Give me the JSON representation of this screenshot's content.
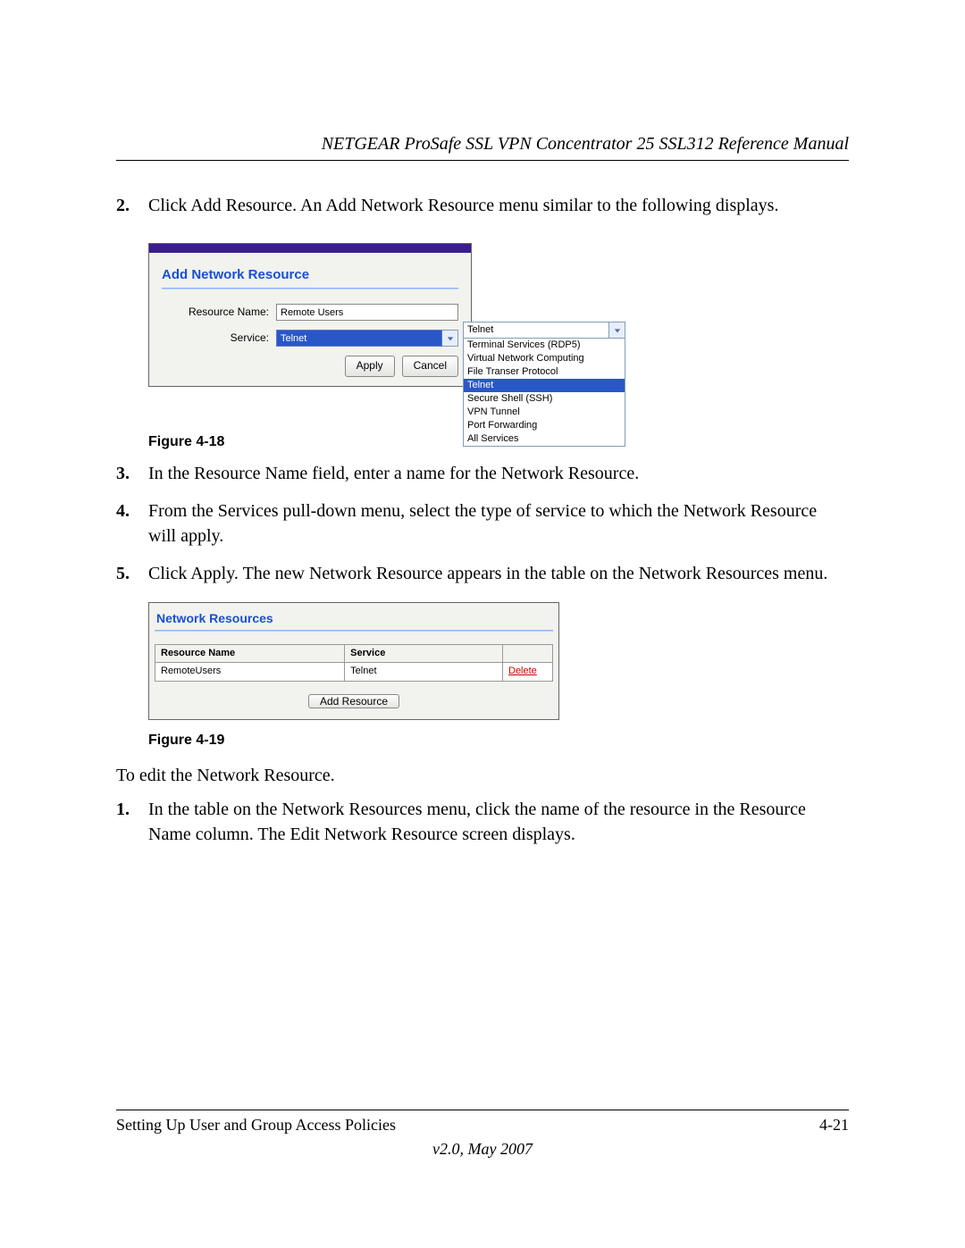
{
  "header": "NETGEAR ProSafe SSL VPN Concentrator 25 SSL312 Reference Manual",
  "steps_a": {
    "s2": {
      "num": "2.",
      "text": "Click Add Resource. An Add Network Resource menu similar to the following displays."
    }
  },
  "fig18": {
    "caption": "Figure 4-18",
    "panel_title": "Add Network Resource",
    "label_resource_name": "Resource Name:",
    "value_resource_name": "Remote Users",
    "label_service": "Service:",
    "value_service": "Telnet",
    "btn_apply": "Apply",
    "btn_cancel": "Cancel",
    "dropdown_selected": "Telnet",
    "options": [
      "Terminal Services (RDP5)",
      "Virtual Network Computing",
      "File Transer Protocol",
      "Telnet",
      "Secure Shell (SSH)",
      "VPN Tunnel",
      "Port Forwarding",
      "All Services"
    ]
  },
  "steps_b": {
    "s3": {
      "num": "3.",
      "text": "In the Resource Name field, enter a name for the Network Resource."
    },
    "s4": {
      "num": "4.",
      "text": "From the Services pull-down menu, select the type of service to which the Network Resource will apply."
    },
    "s5": {
      "num": "5.",
      "text": "Click Apply. The new Network Resource appears in the table on the Network Resources menu."
    }
  },
  "fig19": {
    "caption": "Figure 4-19",
    "panel_title": "Network Resources",
    "col_resource": "Resource Name",
    "col_service": "Service",
    "row_resource": "RemoteUsers",
    "row_service": "Telnet",
    "row_action": "Delete",
    "btn_add": "Add Resource"
  },
  "after_fig19": {
    "intro": "To edit the Network Resource.",
    "s1": {
      "num": "1.",
      "text": "In the table on the Network Resources menu, click the name of the resource in the Resource Name column. The Edit Network Resource screen displays."
    }
  },
  "footer": {
    "left": "Setting Up User and Group Access Policies",
    "right": "4-21",
    "version": "v2.0, May 2007"
  }
}
